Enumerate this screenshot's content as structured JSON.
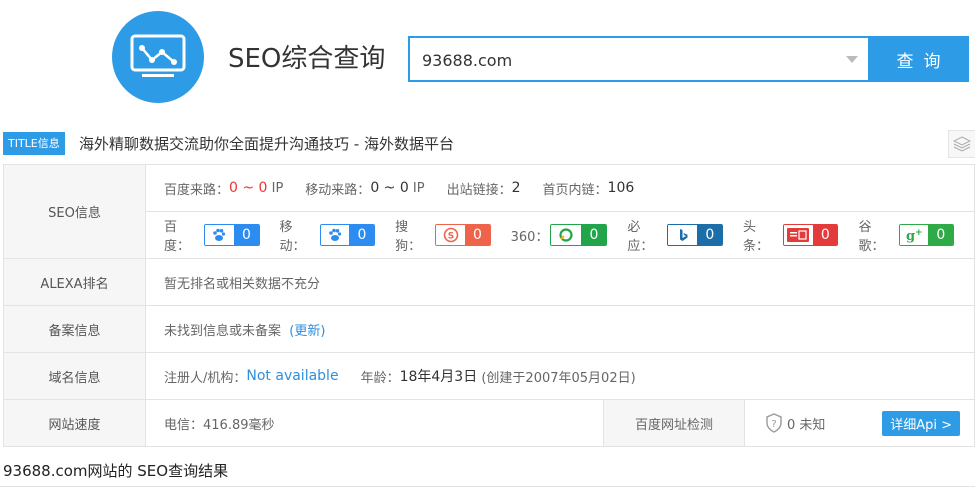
{
  "brand": {
    "title": "SEO综合查询"
  },
  "search": {
    "value": "93688.com",
    "button": "查询"
  },
  "page_title": {
    "tag": "TITLE信息",
    "text": "海外精聊数据交流助你全面提升沟通技巧 - 海外数据平台"
  },
  "seo_info": {
    "label": "SEO信息",
    "baidu_traffic_key": "百度来路：",
    "baidu_traffic_value": "0 ~ 0",
    "baidu_traffic_unit": "IP",
    "mobile_traffic_key": "移动来路：",
    "mobile_traffic_value": "0 ~ 0",
    "mobile_traffic_unit": "IP",
    "outbound_key": "出站链接：",
    "outbound_value": "2",
    "internal_key": "首页内链：",
    "internal_value": "106",
    "engines": [
      {
        "label": "百度：",
        "value": "0",
        "icon": "paw-icon",
        "color": "#2d8cf0"
      },
      {
        "label": "移动：",
        "value": "0",
        "icon": "paw-icon",
        "color": "#2d8cf0"
      },
      {
        "label": "搜狗：",
        "value": "0",
        "icon": "sogou-icon",
        "color": "#f0634b"
      },
      {
        "label": "360：",
        "value": "0",
        "icon": "360-icon",
        "color": "#21a44a"
      },
      {
        "label": "必应：",
        "value": "0",
        "icon": "bing-icon",
        "color": "#1b6ea8"
      },
      {
        "label": "头条：",
        "value": "0",
        "icon": "toutiao-icon",
        "color": "#e33a3a"
      },
      {
        "label": "谷歌：",
        "value": "0",
        "icon": "gplus-icon",
        "color": "#2eaa47"
      }
    ]
  },
  "alexa": {
    "label": "ALEXA排名",
    "text": "暂无排名或相关数据不充分"
  },
  "beian": {
    "label": "备案信息",
    "text": "未找到信息或未备案",
    "link": "(更新)"
  },
  "domain": {
    "label": "域名信息",
    "registrant_key": "注册人/机构：",
    "registrant_value": "Not available",
    "age_key": "年龄：",
    "age_value": "18年4月3日",
    "created": "(创建于2007年05月02日)"
  },
  "speed": {
    "label": "网站速度",
    "telecom": "电信：416.89毫秒",
    "check_label": "百度网址检测",
    "check_value": "0 未知",
    "api_button": "详细Api >"
  },
  "footer": {
    "text": "93688.com网站的 SEO查询结果"
  }
}
